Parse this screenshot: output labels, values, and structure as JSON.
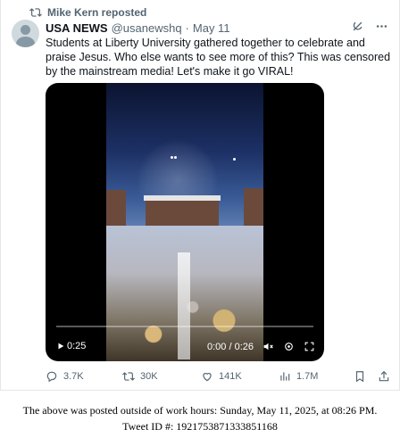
{
  "repost": {
    "icon": "repost-icon",
    "text": "Mike Kern reposted"
  },
  "tweet": {
    "author_name": "USA NEWS",
    "author_handle": "@usanewshq",
    "separator": "·",
    "date": "May 11",
    "text": "Students at Liberty University gathered together to celebrate and praise Jesus. Who else wants to see more of this? This was censored by the mainstream media! Let's make it go VIRAL!",
    "icons": [
      "grok-icon",
      "more-icon"
    ]
  },
  "video": {
    "elapsed": "0:25",
    "time_display": "0:00 / 0:26",
    "controls": [
      "volume-icon",
      "settings-icon",
      "fullscreen-icon"
    ]
  },
  "actions": {
    "replies": "3.7K",
    "reposts": "30K",
    "likes": "141K",
    "views": "1.7M"
  },
  "footer": {
    "line1": "The above was posted outside of work hours: Sunday, May 11, 2025, at 08:26 PM.",
    "line2": "Tweet ID #: 1921753871333851168"
  },
  "colors": {
    "text": "#0f1419",
    "muted": "#536471",
    "video_bg": "#000000"
  }
}
